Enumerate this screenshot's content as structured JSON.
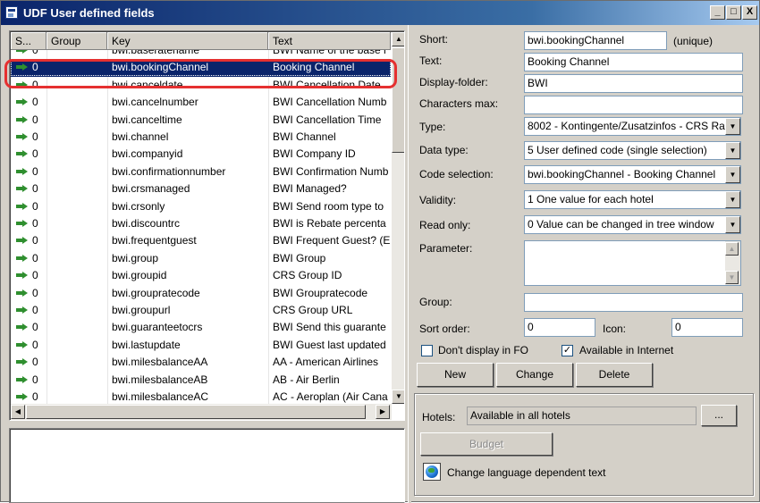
{
  "window": {
    "title": "UDF User defined fields",
    "controls": {
      "minimize": "_",
      "maximize": "□",
      "close": "X"
    }
  },
  "list": {
    "columns": [
      "S...",
      "Group",
      "Key",
      "Text"
    ],
    "rows": [
      {
        "status": "0",
        "group": "",
        "key": "bwi.baseratename",
        "text": "BWI Name of the base r"
      },
      {
        "status": "0",
        "group": "",
        "key": "bwi.bookingChannel",
        "text": "Booking Channel",
        "selected": true
      },
      {
        "status": "0",
        "group": "",
        "key": "bwi.canceldate",
        "text": "BWI Cancellation Date"
      },
      {
        "status": "0",
        "group": "",
        "key": "bwi.cancelnumber",
        "text": "BWI Cancellation Numb"
      },
      {
        "status": "0",
        "group": "",
        "key": "bwi.canceltime",
        "text": "BWI Cancellation Time"
      },
      {
        "status": "0",
        "group": "",
        "key": "bwi.channel",
        "text": "BWI Channel"
      },
      {
        "status": "0",
        "group": "",
        "key": "bwi.companyid",
        "text": "BWI Company ID"
      },
      {
        "status": "0",
        "group": "",
        "key": "bwi.confirmationnumber",
        "text": "BWI Confirmation Numb"
      },
      {
        "status": "0",
        "group": "",
        "key": "bwi.crsmanaged",
        "text": "BWI Managed?"
      },
      {
        "status": "0",
        "group": "",
        "key": "bwi.crsonly",
        "text": "BWI Send room type to"
      },
      {
        "status": "0",
        "group": "",
        "key": "bwi.discountrc",
        "text": "BWI is Rebate percenta"
      },
      {
        "status": "0",
        "group": "",
        "key": "bwi.frequentguest",
        "text": "BWI Frequent Guest? (E"
      },
      {
        "status": "0",
        "group": "",
        "key": "bwi.group",
        "text": "BWI Group"
      },
      {
        "status": "0",
        "group": "",
        "key": "bwi.groupid",
        "text": "CRS Group ID"
      },
      {
        "status": "0",
        "group": "",
        "key": "bwi.groupratecode",
        "text": "BWI Groupratecode"
      },
      {
        "status": "0",
        "group": "",
        "key": "bwi.groupurl",
        "text": "CRS Group URL"
      },
      {
        "status": "0",
        "group": "",
        "key": "bwi.guaranteetocrs",
        "text": "BWI Send this guarante"
      },
      {
        "status": "0",
        "group": "",
        "key": "bwi.lastupdate",
        "text": "BWI Guest last updated"
      },
      {
        "status": "0",
        "group": "",
        "key": "bwi.milesbalanceAA",
        "text": "AA - American Airlines"
      },
      {
        "status": "0",
        "group": "",
        "key": "bwi.milesbalanceAB",
        "text": "AB - Air Berlin"
      },
      {
        "status": "0",
        "group": "",
        "key": "bwi.milesbalanceAC",
        "text": "AC - Aeroplan (Air Cana"
      }
    ]
  },
  "form": {
    "short_label": "Short:",
    "short_value": "bwi.bookingChannel",
    "unique_label": "(unique)",
    "text_label": "Text:",
    "text_value": "Booking Channel",
    "folder_label": "Display-folder:",
    "folder_value": "BWI",
    "charsmax_label": "Characters max:",
    "charsmax_value": "",
    "type_label": "Type:",
    "type_value": "8002 - Kontingente/Zusatzinfos - CRS Ra",
    "datatype_label": "Data type:",
    "datatype_value": "5 User defined code (single selection)",
    "codesel_label": "Code selection:",
    "codesel_value": "bwi.bookingChannel  - Booking Channel",
    "validity_label": "Validity:",
    "validity_value": "1 One value for each hotel",
    "readonly_label": "Read only:",
    "readonly_value": "0 Value can be changed in tree window",
    "parameter_label": "Parameter:",
    "group_label": "Group:",
    "group_value": "",
    "sort_label": "Sort order:",
    "sort_value": "0",
    "icon_label": "Icon:",
    "icon_value": "0",
    "dont_display_label": "Don't display in FO",
    "dont_display_checked": false,
    "internet_label": "Available in Internet",
    "internet_checked": true,
    "internet_check_mark": "✓",
    "new_button": "New",
    "change_button": "Change",
    "delete_button": "Delete"
  },
  "hotels": {
    "label": "Hotels:",
    "value": "Available in all hotels",
    "browse_button": "...",
    "budget_button": "Budget",
    "language_link": "Change language dependent text"
  }
}
